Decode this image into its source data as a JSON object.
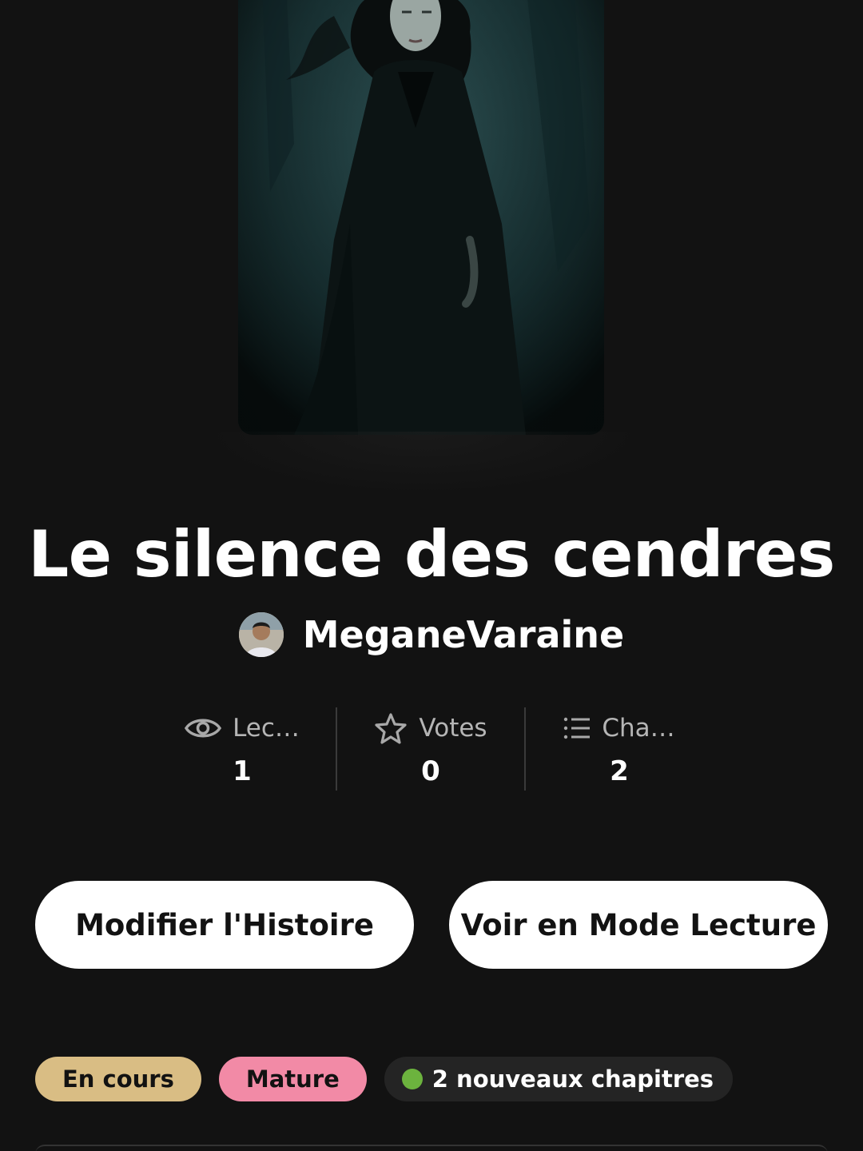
{
  "story": {
    "title": "Le silence des cendres",
    "author": "MeganeVaraine"
  },
  "stats": {
    "reads": {
      "label": "Lec…",
      "value": "1",
      "icon": "eye-icon"
    },
    "votes": {
      "label": "Votes",
      "value": "0",
      "icon": "star-icon"
    },
    "chapters": {
      "label": "Cha…",
      "value": "2",
      "icon": "list-icon"
    }
  },
  "actions": {
    "edit_label": "Modifier l'Histoire",
    "read_label": "Voir en Mode Lecture"
  },
  "tags": {
    "status": "En cours",
    "rating": "Mature",
    "new_chapters": "2 nouveaux chapitres"
  },
  "colors": {
    "background": "#121212",
    "status_tag": "#d9bd84",
    "mature_tag": "#f28aa6",
    "new_dot": "#6cb33e",
    "button": "#ffffff"
  }
}
